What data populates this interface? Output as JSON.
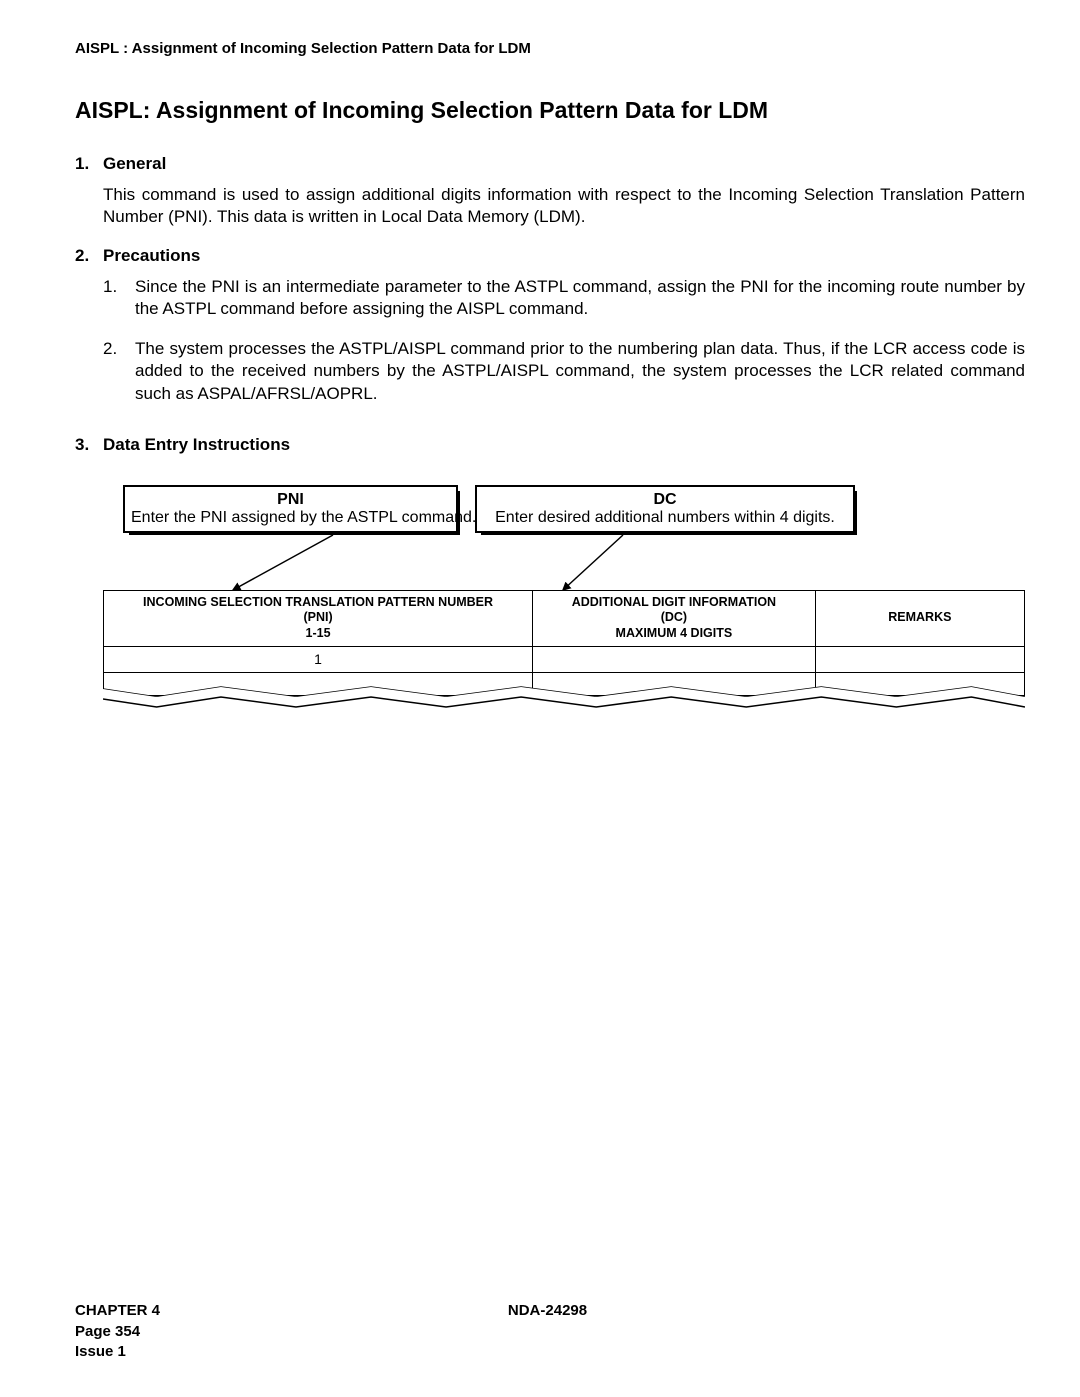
{
  "header": "AISPL : Assignment of Incoming Selection Pattern Data for LDM",
  "title": "AISPL: Assignment of Incoming Selection Pattern Data for LDM",
  "sections": {
    "general": {
      "num": "1.",
      "label": "General",
      "body": "This command is used to assign additional digits information with respect to the Incoming Selection Translation Pattern Number (PNI). This data is written in Local Data Memory (LDM)."
    },
    "precautions": {
      "num": "2.",
      "label": "Precautions",
      "items": [
        {
          "num": "1.",
          "body": "Since the PNI is an intermediate parameter to the ASTPL command, assign the PNI for the incoming route number by the ASTPL command before assigning the AISPL command."
        },
        {
          "num": "2.",
          "body": "The system processes the ASTPL/AISPL command prior to the numbering plan data. Thus, if the LCR access code is added to the received numbers by the ASTPL/AISPL command, the system processes the LCR related command such as ASPAL/AFRSL/AOPRL."
        }
      ]
    },
    "data_entry": {
      "num": "3.",
      "label": "Data Entry Instructions"
    }
  },
  "callouts": {
    "pni": {
      "title": "PNI",
      "sub": "Enter the PNI assigned by the ASTPL command."
    },
    "dc": {
      "title": "DC",
      "sub": "Enter desired additional numbers within 4 digits."
    }
  },
  "table": {
    "headers": {
      "col1_line1": "INCOMING SELECTION TRANSLATION PATTERN NUMBER",
      "col1_line2": "(PNI)",
      "col1_line3": "1-15",
      "col2_line1": "ADDITIONAL DIGIT INFORMATION",
      "col2_line2": "(DC)",
      "col2_line3": "MAXIMUM 4 DIGITS",
      "col3": "REMARKS"
    },
    "rows": [
      {
        "c1": "1",
        "c2": "",
        "c3": ""
      },
      {
        "c1": "",
        "c2": "",
        "c3": ""
      }
    ]
  },
  "footer": {
    "chapter": "CHAPTER 4",
    "page": "Page 354",
    "issue": "Issue 1",
    "doc": "NDA-24298"
  }
}
